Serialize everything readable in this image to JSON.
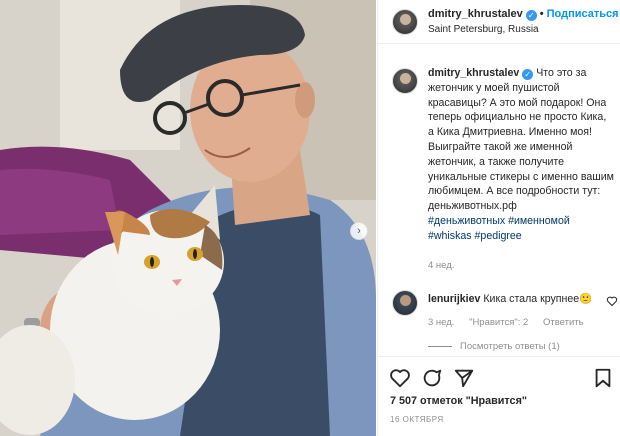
{
  "header": {
    "username": "dmitry_khrustalev",
    "separator": "•",
    "follow_label": "Подписаться",
    "location": "Saint Petersburg, Russia"
  },
  "caption": {
    "username": "dmitry_khrustalev",
    "text_1": "Что это за жетончик у моей пушистой красавицы? А это мой подарок! Она теперь официально не просто Кика, а Кика Дмитриевна. Именно моя!",
    "text_2": "Выиграйте такой же именной жетончик, а также получите уникальные стикеры с именно вашим любимцем. А все подробности тут: деньживотных.рф",
    "hashtags": [
      "#деньживотных",
      "#именномой",
      "#whiskas",
      "#pedigree"
    ],
    "time": "4 нед."
  },
  "comment": {
    "username": "lenurijkiev",
    "text": "Кика стала крупнее🙂",
    "time": "3 нед.",
    "likes": "\"Нравится\": 2",
    "reply_label": "Ответить",
    "view_replies": "Посмотреть ответы (1)"
  },
  "post": {
    "likes": "7 507 отметок \"Нравится\"",
    "date": "16 октября"
  },
  "icons": [
    "heart-icon",
    "comment-icon",
    "share-icon",
    "bookmark-icon",
    "verified-icon",
    "chevron-right-icon"
  ],
  "colors": {
    "accent": "#0095f6",
    "verified": "#3897f0",
    "hashtag": "#00376b",
    "muted": "#8e8e8e"
  }
}
